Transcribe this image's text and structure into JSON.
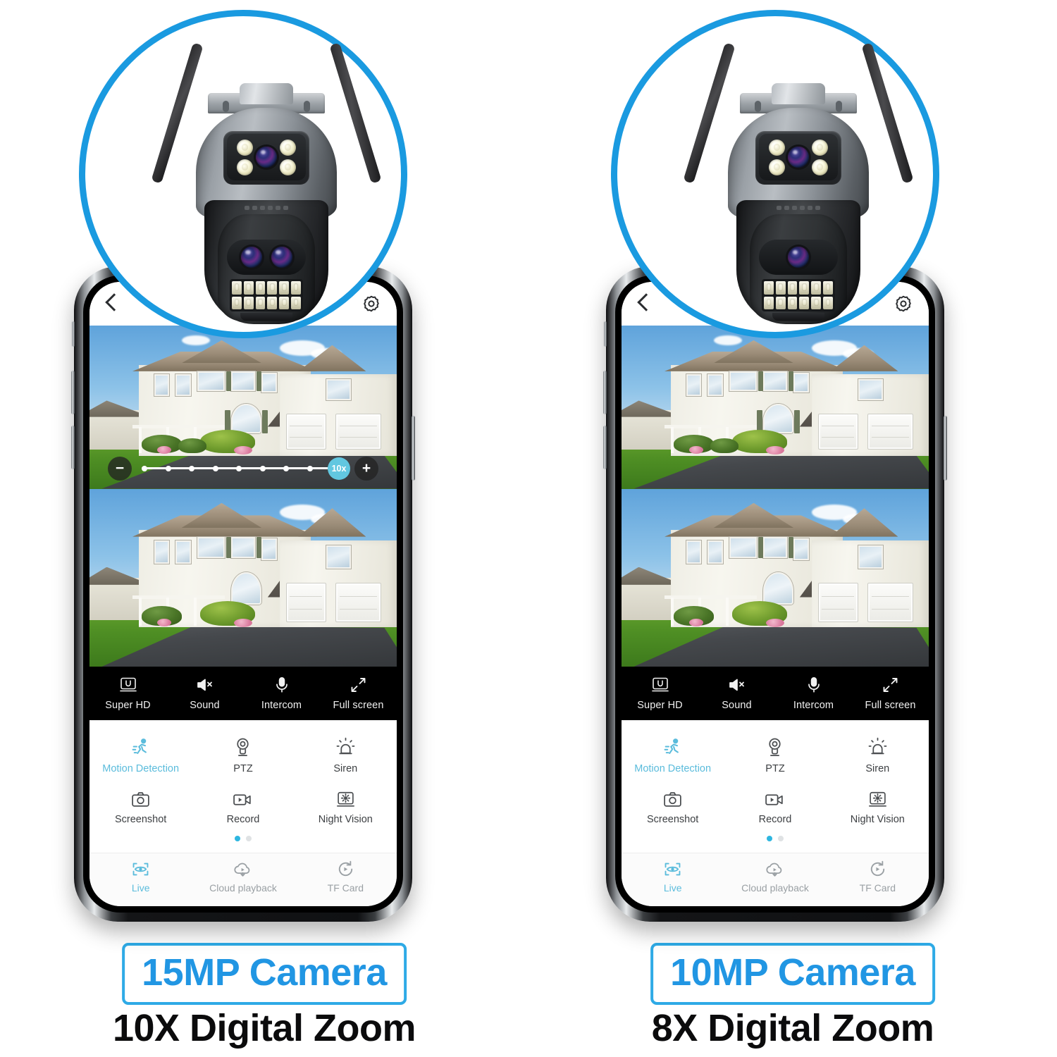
{
  "theme": {
    "accent_blue": "#2196e3",
    "circle_blue": "#1a9ae0",
    "app_cyan": "#5bbcdc",
    "toolbar_bg": "#000000",
    "page_bg": "#ffffff"
  },
  "panels": [
    {
      "id": "left",
      "caption": {
        "badge": "15MP Camera",
        "subtitle": "10X Digital Zoom"
      },
      "camera": {
        "name": "ptz-security-camera-3-lens",
        "lower_lens_count": 2
      },
      "app": {
        "topbar": {
          "back": "back-chevron-icon",
          "settings": "gear-icon"
        },
        "zoom_slider": {
          "visible": true,
          "minus": "−",
          "plus": "+",
          "value_label": "10x",
          "dot_count": 9
        },
        "toolbar": [
          {
            "icon": "super-hd-icon",
            "label": "Super HD"
          },
          {
            "icon": "sound-muted-icon",
            "label": "Sound"
          },
          {
            "icon": "microphone-icon",
            "label": "Intercom"
          },
          {
            "icon": "fullscreen-icon",
            "label": "Full screen"
          }
        ],
        "features": [
          {
            "icon": "running-person-icon",
            "label": "Motion Detection",
            "active": true
          },
          {
            "icon": "ptz-camera-icon",
            "label": "PTZ",
            "active": false
          },
          {
            "icon": "siren-icon",
            "label": "Siren",
            "active": false
          },
          {
            "icon": "camera-shutter-icon",
            "label": "Screenshot",
            "active": false
          },
          {
            "icon": "video-record-icon",
            "label": "Record",
            "active": false
          },
          {
            "icon": "night-vision-icon",
            "label": "Night Vision",
            "active": false
          }
        ],
        "pager": {
          "pages": 2,
          "current": 1
        },
        "bottom_nav": [
          {
            "icon": "live-eye-icon",
            "label": "Live",
            "active": true
          },
          {
            "icon": "cloud-playback-icon",
            "label": "Cloud playback",
            "active": false
          },
          {
            "icon": "tf-card-icon",
            "label": "TF Card",
            "active": false
          }
        ]
      }
    },
    {
      "id": "right",
      "caption": {
        "badge": "10MP Camera",
        "subtitle": "8X Digital Zoom"
      },
      "camera": {
        "name": "ptz-security-camera-2-lens",
        "lower_lens_count": 1
      },
      "app": {
        "topbar": {
          "back": "back-chevron-icon",
          "settings": "gear-icon"
        },
        "zoom_slider": {
          "visible": false,
          "minus": "−",
          "plus": "+",
          "value_label": "",
          "dot_count": 0
        },
        "toolbar": [
          {
            "icon": "super-hd-icon",
            "label": "Super HD"
          },
          {
            "icon": "sound-muted-icon",
            "label": "Sound"
          },
          {
            "icon": "microphone-icon",
            "label": "Intercom"
          },
          {
            "icon": "fullscreen-icon",
            "label": "Full screen"
          }
        ],
        "features": [
          {
            "icon": "running-person-icon",
            "label": "Motion Detection",
            "active": true
          },
          {
            "icon": "ptz-camera-icon",
            "label": "PTZ",
            "active": false
          },
          {
            "icon": "siren-icon",
            "label": "Siren",
            "active": false
          },
          {
            "icon": "camera-shutter-icon",
            "label": "Screenshot",
            "active": false
          },
          {
            "icon": "video-record-icon",
            "label": "Record",
            "active": false
          },
          {
            "icon": "night-vision-icon",
            "label": "Night Vision",
            "active": false
          }
        ],
        "pager": {
          "pages": 2,
          "current": 1
        },
        "bottom_nav": [
          {
            "icon": "live-eye-icon",
            "label": "Live",
            "active": true
          },
          {
            "icon": "cloud-playback-icon",
            "label": "Cloud playback",
            "active": false
          },
          {
            "icon": "tf-card-icon",
            "label": "TF Card",
            "active": false
          }
        ]
      }
    }
  ]
}
